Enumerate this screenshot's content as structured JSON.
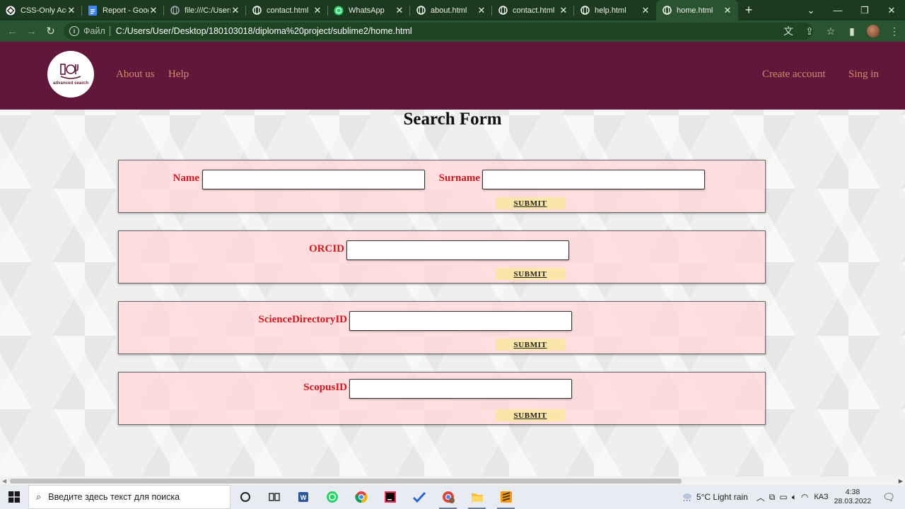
{
  "browser": {
    "tabs": [
      {
        "title": "CSS-Only Acc",
        "favicon": "codepen"
      },
      {
        "title": "Report - Goog",
        "favicon": "docs"
      },
      {
        "title": "file:///C:/Users",
        "favicon": "globe"
      },
      {
        "title": "contact.html",
        "favicon": "globe"
      },
      {
        "title": "WhatsApp",
        "favicon": "whatsapp"
      },
      {
        "title": "about.html",
        "favicon": "globe"
      },
      {
        "title": "contact.html",
        "favicon": "globe"
      },
      {
        "title": "help.html",
        "favicon": "globe"
      },
      {
        "title": "home.html",
        "favicon": "globe",
        "active": true
      }
    ],
    "address": {
      "scheme_label": "Файл",
      "url": "C:/Users/User/Desktop/180103018/diploma%20project/sublime2/home.html"
    }
  },
  "site": {
    "logo_text": "advanced search",
    "nav_left": [
      "About us",
      "Help"
    ],
    "nav_right": [
      "Create account",
      "Sing in"
    ],
    "colors": {
      "header": "#601739",
      "nav_link": "#d68a6f",
      "label": "#d4181e",
      "submit": "#fbe6a9"
    }
  },
  "form": {
    "title": "Search Form",
    "submit_label": "SUBMIT",
    "name_label": "Name",
    "surname_label": "Surname",
    "orcid_label": "ORCID",
    "science_label": "ScienceDirectoryID",
    "scopus_label": "ScopusID"
  },
  "taskbar": {
    "search_placeholder": "Введите здесь текст для поиска",
    "weather": "5°C  Light rain",
    "language": "КАЗ",
    "time": "4:38",
    "date": "28.03.2022"
  }
}
